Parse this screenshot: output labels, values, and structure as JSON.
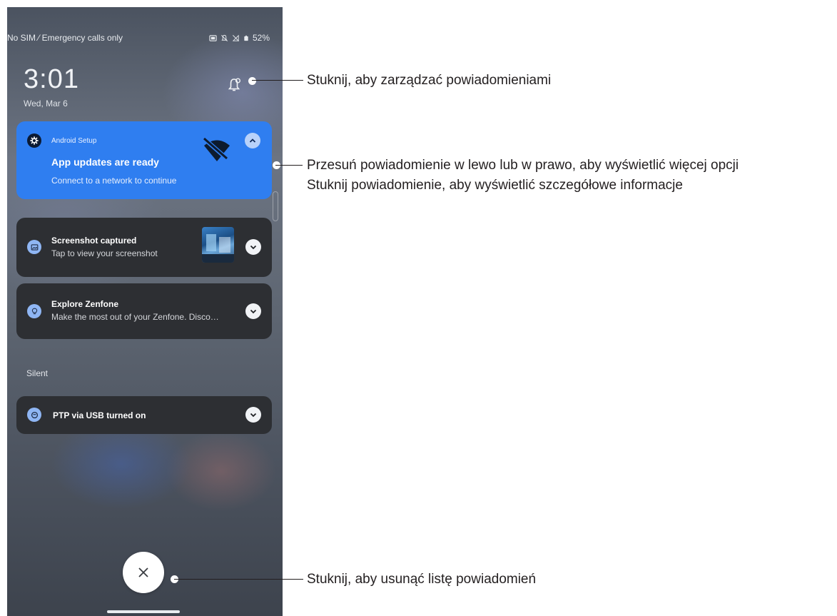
{
  "status_bar": {
    "carrier": "No SIM ⁄ Emergency calls only",
    "battery": "52%",
    "icons": [
      "sim-card-icon",
      "mute-icon",
      "no-signal-icon",
      "battery-icon"
    ]
  },
  "lockscreen": {
    "time": "3:01",
    "date": "Wed, Mar 6",
    "manage_icon": "notification-settings-bell-icon"
  },
  "notifications": [
    {
      "app": "Android Setup",
      "title": "App updates are ready",
      "text": "Connect to a network to continue",
      "color": "#2f7ef0",
      "icon": "gear-icon",
      "badge_icon": "wifi-off-icon",
      "expanded": true
    },
    {
      "title": "Screenshot captured",
      "text": "Tap to view your screenshot",
      "icon": "image-icon",
      "has_thumbnail": true,
      "expanded": false
    },
    {
      "title": "Explore Zenfone",
      "text": "Make the most out of your Zenfone. Disco…",
      "icon": "lightbulb-icon",
      "expanded": false
    }
  ],
  "silent_section": {
    "label": "Silent",
    "items": [
      {
        "title": "PTP via USB turned on",
        "icon": "usb-icon",
        "expanded": false
      }
    ]
  },
  "clear_button_icon": "close-icon",
  "callouts": {
    "manage": "Stuknij, aby zarządzać powiadomieniami",
    "swipe_line1": "Przesuń powiadomienie w lewo lub w prawo, aby wyświetlić więcej opcji",
    "swipe_line2": "Stuknij powiadomienie, aby wyświetlić szczegółowe informacje",
    "clear": "Stuknij, aby usunąć listę powiadomień"
  },
  "colors": {
    "accent_blue": "#2f7ef0",
    "card_dark": "#2d2f33",
    "icon_bubble": "#8fb6f4",
    "callout_text": "#231f20"
  }
}
